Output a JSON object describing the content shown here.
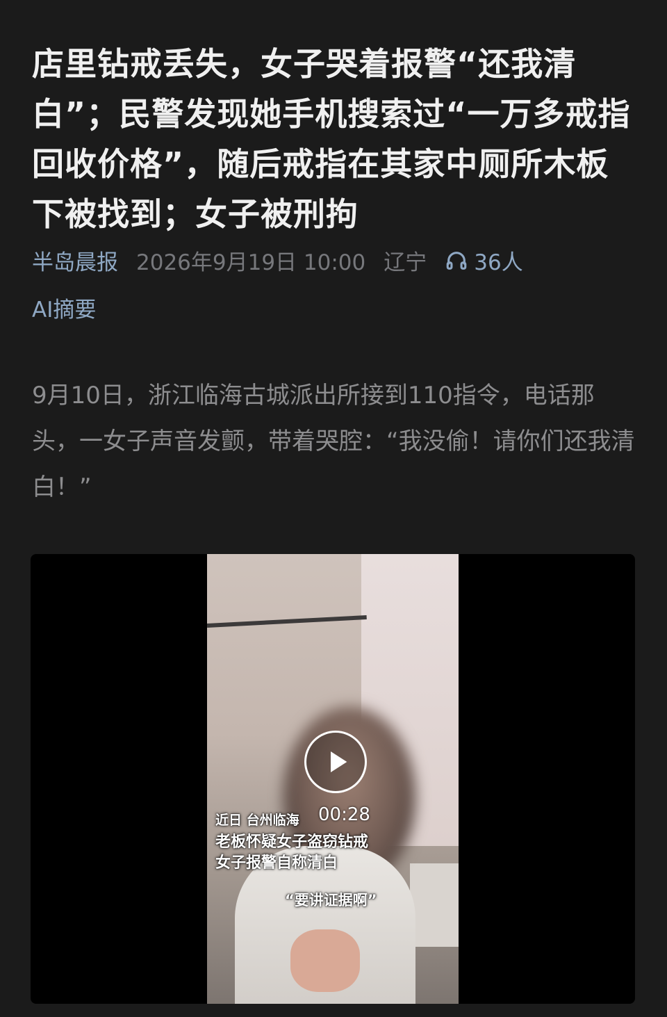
{
  "article": {
    "title": "店里钻戒丢失，女子哭着报警“还我清白”；民警发现她手机搜索过“一万多戒指回收价格”，随后戒指在其家中厕所木板下被找到；女子被刑拘",
    "source": "半岛晨报",
    "date": "2026年9月19日 10:00",
    "location": "辽宁",
    "listeners": "36人",
    "ai_summary_label": "AI摘要",
    "body": "9月10日，浙江临海古城派出所接到110指令，电话那头，一女子声音发颤，带着哭腔：“我没偷！请你们还我清白！”"
  },
  "video": {
    "duration": "00:28",
    "caption_line1": "近日 台州临海",
    "caption_line2": "老板怀疑女子盗窃钻戒",
    "caption_line3": "女子报警自称清白",
    "quote": "“要讲证据啊”"
  },
  "icons": {
    "listen": "headphones-icon",
    "play": "play-icon"
  },
  "colors": {
    "background": "#1b1b1b",
    "title": "#f0f0f0",
    "link": "#8fa8c4",
    "meta": "#77787c",
    "body": "#8d8d8f"
  }
}
